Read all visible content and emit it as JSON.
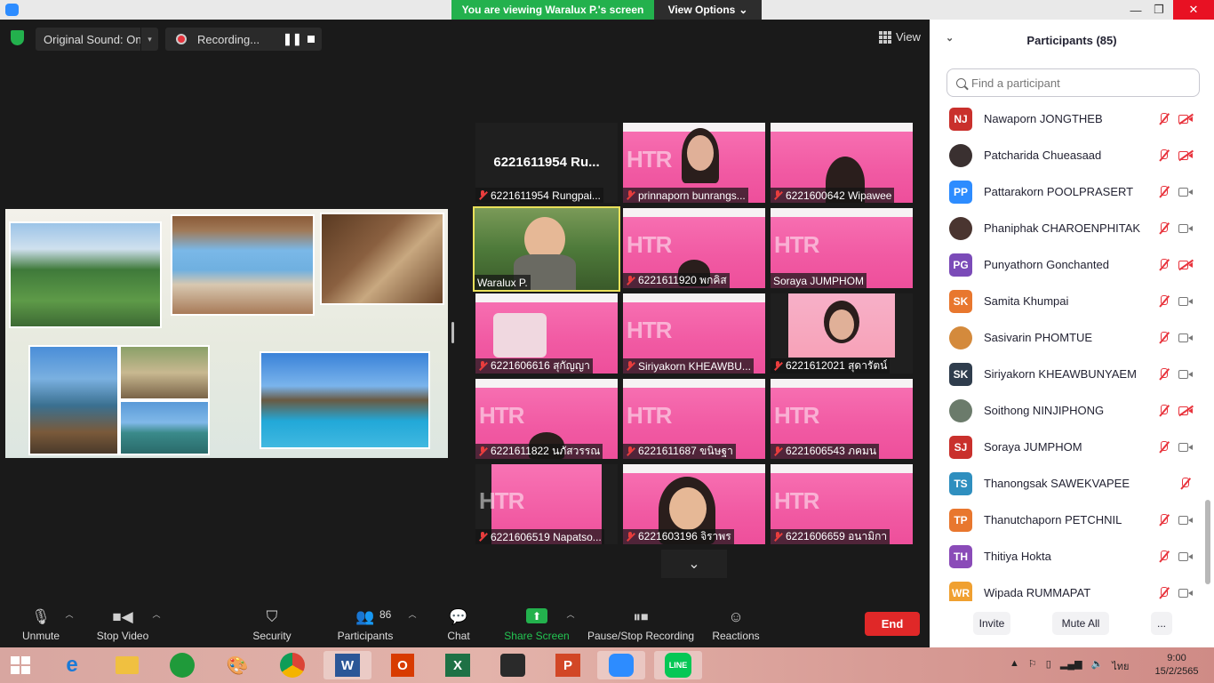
{
  "titlebar": {
    "viewing_text": "You are viewing Waralux P.'s screen",
    "view_options": "View Options",
    "minimize_glyph": "—",
    "maximize_glyph": "❐",
    "close_glyph": "✕"
  },
  "meeting": {
    "original_sound": "Original Sound: On",
    "recording": "Recording...",
    "view_label": "View"
  },
  "gallery": [
    {
      "label": "6221611954 Rungpai...",
      "bigname": "6221611954 Ru...",
      "kind": "dark"
    },
    {
      "label": "prinnaporn bunrangs...",
      "kind": "pink"
    },
    {
      "label": "6221600642 Wipawee",
      "kind": "pink"
    },
    {
      "label": "Waralux P.",
      "kind": "video"
    },
    {
      "label": "6221611920 พกคิส",
      "kind": "pink"
    },
    {
      "label": "Soraya JUMPHOM",
      "kind": "pink"
    },
    {
      "label": "6221606616 สุกัญญา",
      "kind": "pink"
    },
    {
      "label": "Siriyakorn KHEAWBU...",
      "kind": "pink"
    },
    {
      "label": "6221612021 สุดารัตน์",
      "kind": "dark"
    },
    {
      "label": "6221611822 นภัสวรรณ",
      "kind": "pink"
    },
    {
      "label": "6221611687 ขนิษฐา",
      "kind": "pink"
    },
    {
      "label": "6221606543 ภคมน",
      "kind": "pink"
    },
    {
      "label": "6221606519 Napatso...",
      "kind": "pink"
    },
    {
      "label": "6221603196 จิราพร",
      "kind": "pink"
    },
    {
      "label": "6221606659 อนามิกา",
      "kind": "pink"
    }
  ],
  "slide": {
    "htr": "HTR"
  },
  "toolbar": {
    "unmute": "Unmute",
    "stop_video": "Stop Video",
    "security": "Security",
    "participants": "Participants",
    "participants_count": "86",
    "chat": "Chat",
    "share_screen": "Share Screen",
    "pause_stop_recording": "Pause/Stop Recording",
    "reactions": "Reactions",
    "end": "End"
  },
  "panel": {
    "title": "Participants (85)",
    "search_placeholder": "Find a participant",
    "participants": [
      {
        "initials": "NJ",
        "name": "Nawaporn JONGTHEB",
        "color": "#c9302c",
        "photo": false,
        "video": "off"
      },
      {
        "initials": "",
        "name": "Patcharida Chueasaad",
        "color": "#3a3030",
        "photo": true,
        "video": "off"
      },
      {
        "initials": "PP",
        "name": "Pattarakorn POOLPRASERT",
        "color": "#2d8cff",
        "photo": false,
        "video": "on"
      },
      {
        "initials": "",
        "name": "Phaniphak CHAROENPHITAKPO...",
        "color": "#4a3530",
        "photo": true,
        "video": "on"
      },
      {
        "initials": "PG",
        "name": "Punyathorn Gonchanted",
        "color": "#7b4bb8",
        "photo": false,
        "video": "off"
      },
      {
        "initials": "SK",
        "name": "Samita Khumpai",
        "color": "#e8772e",
        "photo": false,
        "video": "on"
      },
      {
        "initials": "",
        "name": "Sasivarin PHOMTUE",
        "color": "#d48a3c",
        "photo": true,
        "video": "on"
      },
      {
        "initials": "SK",
        "name": "Siriyakorn KHEAWBUNYAEM",
        "color": "#2f3d4d",
        "photo": false,
        "video": "on"
      },
      {
        "initials": "",
        "name": "Soithong NINJIPHONG",
        "color": "#6b7b6b",
        "photo": true,
        "video": "off"
      },
      {
        "initials": "SJ",
        "name": "Soraya JUMPHOM",
        "color": "#c9302c",
        "photo": false,
        "video": "on"
      },
      {
        "initials": "TS",
        "name": "Thanongsak SAWEKVAPEE",
        "color": "#2f8fbf",
        "photo": false,
        "video": "none"
      },
      {
        "initials": "TP",
        "name": "Thanutchaporn PETCHNIL",
        "color": "#e8772e",
        "photo": false,
        "video": "on"
      },
      {
        "initials": "TH",
        "name": "Thitiya Hokta",
        "color": "#8a4bb8",
        "photo": false,
        "video": "on"
      },
      {
        "initials": "WR",
        "name": "Wipada RUMMAPAT",
        "color": "#f0a030",
        "photo": false,
        "video": "on"
      }
    ],
    "invite": "Invite",
    "mute_all": "Mute All",
    "more": "..."
  },
  "taskbar": {
    "word": "W",
    "office": "O",
    "excel": "X",
    "powerpoint": "P",
    "line": "LINE",
    "lang": "ไทย",
    "time": "9:00",
    "date": "15/2/2565"
  },
  "colors": {
    "zoom_blue": "#2d8cff",
    "share_green": "#23b14d",
    "end_red": "#e02828",
    "mute_red": "#e8343d",
    "tile_pink": "#f15aa3"
  }
}
